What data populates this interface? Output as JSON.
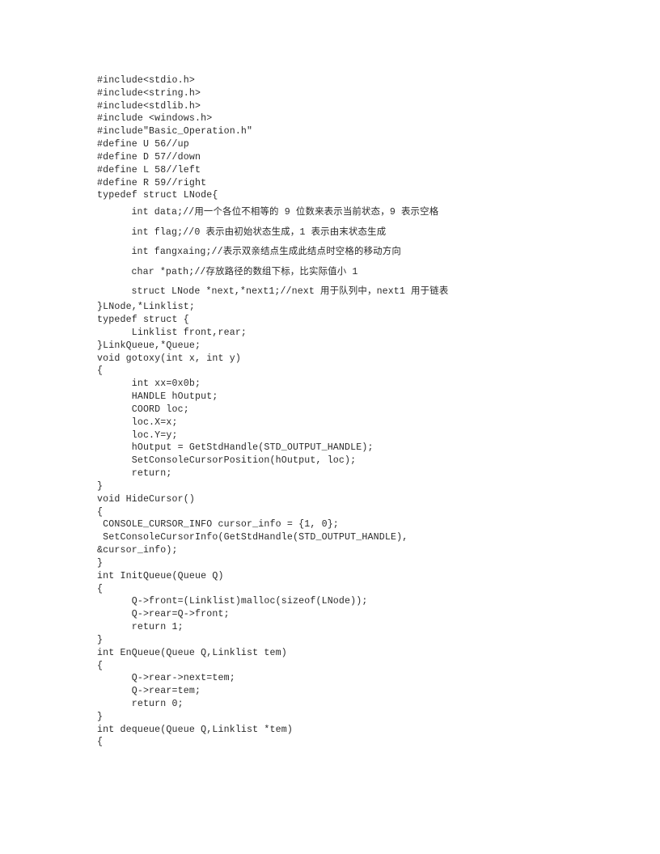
{
  "document": {
    "kind": "source-code-listing",
    "language": "C",
    "page_background": "#ffffff",
    "text_color": "#2a2a2a",
    "lines": [
      {
        "text": "#include<stdio.h>",
        "cjk": false
      },
      {
        "text": "#include<string.h>",
        "cjk": false
      },
      {
        "text": "#include<stdlib.h>",
        "cjk": false
      },
      {
        "text": "#include <windows.h>",
        "cjk": false
      },
      {
        "text": "#include\"Basic_Operation.h\"",
        "cjk": false
      },
      {
        "text": "#define U 56//up",
        "cjk": false
      },
      {
        "text": "#define D 57//down",
        "cjk": false
      },
      {
        "text": "#define L 58//left",
        "cjk": false
      },
      {
        "text": "#define R 59//right",
        "cjk": false
      },
      {
        "text": "typedef struct LNode{",
        "cjk": false
      },
      {
        "text": "      int data;//用一个各位不相等的 9 位数来表示当前状态，9 表示空格",
        "cjk": true
      },
      {
        "text": "      int flag;//0 表示由初始状态生成，1 表示由末状态生成",
        "cjk": true
      },
      {
        "text": "      int fangxaing;//表示双亲结点生成此结点时空格的移动方向",
        "cjk": true
      },
      {
        "text": "      char *path;//存放路径的数组下标，比实际值小 1",
        "cjk": true
      },
      {
        "text": "      struct LNode *next,*next1;//next 用于队列中，next1 用于链表",
        "cjk": true
      },
      {
        "text": "}LNode,*Linklist;",
        "cjk": false
      },
      {
        "text": "typedef struct {",
        "cjk": false
      },
      {
        "text": "      Linklist front,rear;",
        "cjk": false
      },
      {
        "text": "}LinkQueue,*Queue;",
        "cjk": false
      },
      {
        "text": "",
        "cjk": false
      },
      {
        "text": "void gotoxy(int x, int y)",
        "cjk": false
      },
      {
        "text": "{",
        "cjk": false
      },
      {
        "text": "      int xx=0x0b;",
        "cjk": false
      },
      {
        "text": "      HANDLE hOutput;",
        "cjk": false
      },
      {
        "text": "      COORD loc;",
        "cjk": false
      },
      {
        "text": "      loc.X=x;",
        "cjk": false
      },
      {
        "text": "      loc.Y=y;",
        "cjk": false
      },
      {
        "text": "      hOutput = GetStdHandle(STD_OUTPUT_HANDLE);",
        "cjk": false
      },
      {
        "text": "      SetConsoleCursorPosition(hOutput, loc);",
        "cjk": false
      },
      {
        "text": "      return;",
        "cjk": false
      },
      {
        "text": "}",
        "cjk": false
      },
      {
        "text": "void HideCursor()",
        "cjk": false
      },
      {
        "text": "{",
        "cjk": false
      },
      {
        "text": " CONSOLE_CURSOR_INFO cursor_info = {1, 0};",
        "cjk": false
      },
      {
        "text": " SetConsoleCursorInfo(GetStdHandle(STD_OUTPUT_HANDLE),",
        "cjk": false
      },
      {
        "text": "&cursor_info);",
        "cjk": false
      },
      {
        "text": "}",
        "cjk": false
      },
      {
        "text": "int InitQueue(Queue Q)",
        "cjk": false
      },
      {
        "text": "{",
        "cjk": false
      },
      {
        "text": "      Q->front=(Linklist)malloc(sizeof(LNode));",
        "cjk": false
      },
      {
        "text": "      Q->rear=Q->front;",
        "cjk": false
      },
      {
        "text": "      return 1;",
        "cjk": false
      },
      {
        "text": "}",
        "cjk": false
      },
      {
        "text": "int EnQueue(Queue Q,Linklist tem)",
        "cjk": false
      },
      {
        "text": "{",
        "cjk": false
      },
      {
        "text": "      Q->rear->next=tem;",
        "cjk": false
      },
      {
        "text": "      Q->rear=tem;",
        "cjk": false
      },
      {
        "text": "      return 0;",
        "cjk": false
      },
      {
        "text": "}",
        "cjk": false
      },
      {
        "text": "int dequeue(Queue Q,Linklist *tem)",
        "cjk": false
      },
      {
        "text": "{",
        "cjk": false
      }
    ]
  }
}
